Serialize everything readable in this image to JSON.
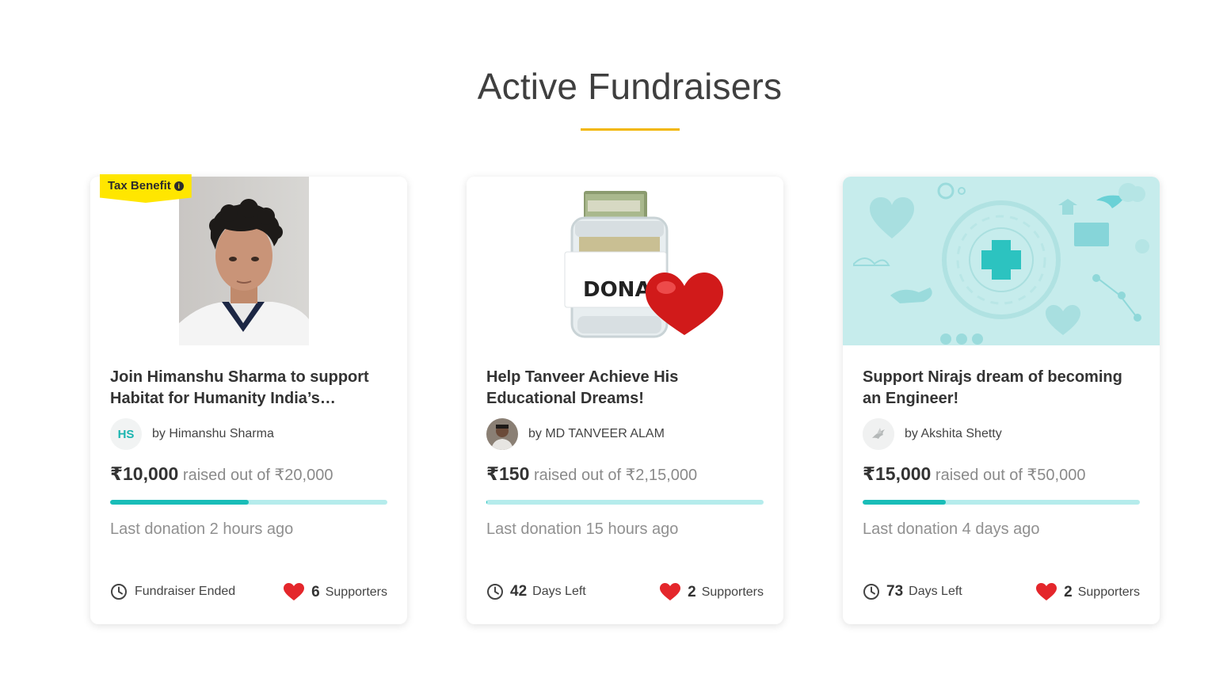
{
  "section": {
    "title": "Active Fundraisers"
  },
  "accent_color": "#f2b705",
  "progress_colors": {
    "fill": "#19bdb8",
    "track": "#b5ecec"
  },
  "cards": [
    {
      "badge": "Tax Benefit",
      "badge_icon": "info-icon",
      "image": "photo-of-young-man",
      "title": "Join Himanshu Sharma to support Habitat for Humanity India’s…",
      "avatar_initials": "HS",
      "author": "by Himanshu Sharma",
      "raised": "₹10,000",
      "goal_text": "raised out of ₹20,000",
      "progress": 0.5,
      "last_donation": "Last donation 2 hours ago",
      "time_status": "Fundraiser Ended",
      "supporters_count": "6",
      "supporters_label": "Supporters"
    },
    {
      "image": "donate-jar-with-heart",
      "image_text": "DONATE",
      "title": "Help Tanveer Achieve His Educational Dreams!",
      "avatar_type": "photo",
      "author": "by MD TANVEER ALAM",
      "raised": "₹150",
      "goal_text": "raised out of ₹2,15,000",
      "progress": 0.0007,
      "last_donation": "Last donation 15 hours ago",
      "days_left": "42",
      "days_left_label": "Days Left",
      "supporters_count": "2",
      "supporters_label": "Supporters"
    },
    {
      "image": "medical-pattern-illustration",
      "title": "Support Nirajs dream of becoming an Engineer!",
      "avatar_type": "bird-placeholder",
      "author": "by Akshita Shetty",
      "raised": "₹15,000",
      "goal_text": "raised out of ₹50,000",
      "progress": 0.3,
      "last_donation": "Last donation 4 days ago",
      "days_left": "73",
      "days_left_label": "Days Left",
      "supporters_count": "2",
      "supporters_label": "Supporters"
    }
  ]
}
